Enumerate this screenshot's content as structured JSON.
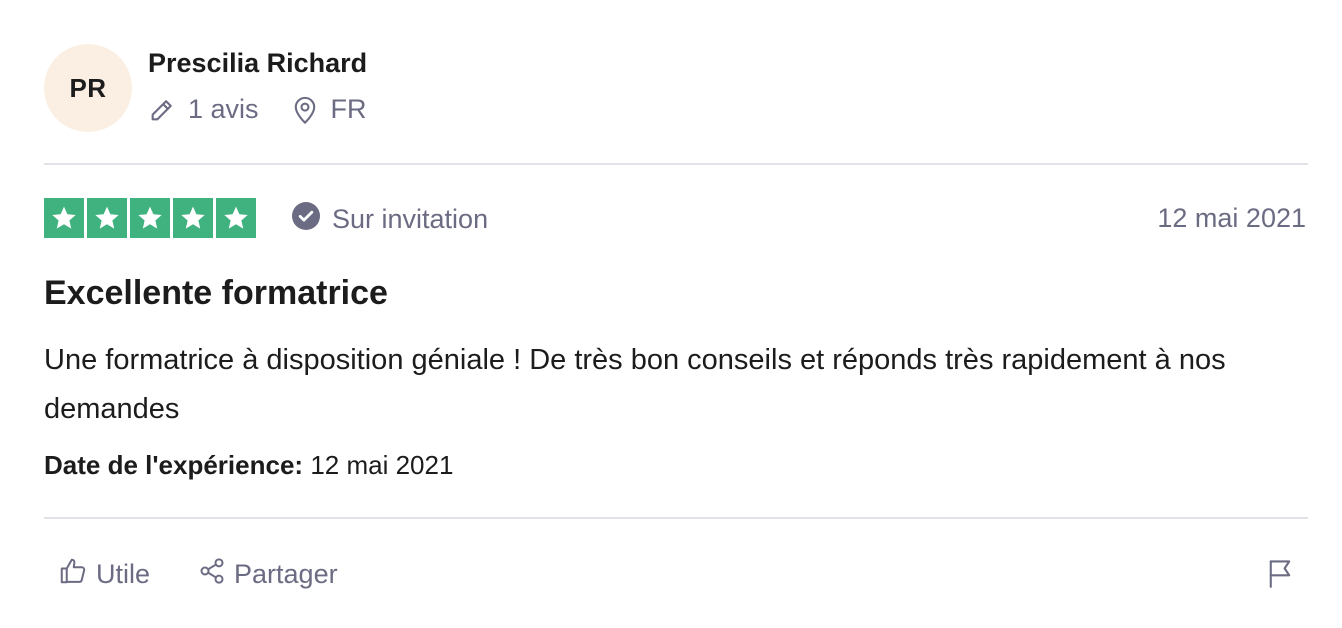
{
  "reviewer": {
    "initials": "PR",
    "name": "Prescilia Richard",
    "review_count": "1 avis",
    "country": "FR",
    "avatar_color": "#fbeee3"
  },
  "review": {
    "rating": 5,
    "rating_max": 5,
    "star_color": "#3fb27f",
    "verified_label": "Sur invitation",
    "date": "12 mai 2021",
    "title": "Excellente formatrice",
    "body": "Une formatrice à disposition géniale ! De très bon conseils et réponds très rapidement à nos demandes",
    "experience_label": "Date de l'expérience:",
    "experience_date": "12 mai 2021"
  },
  "actions": {
    "useful_label": "Utile",
    "share_label": "Partager"
  },
  "icons": {
    "pencil": "pencil-icon",
    "location": "location-pin-icon",
    "verified": "check-circle-icon",
    "thumbs_up": "thumbs-up-icon",
    "share": "share-icon",
    "flag": "flag-icon"
  }
}
